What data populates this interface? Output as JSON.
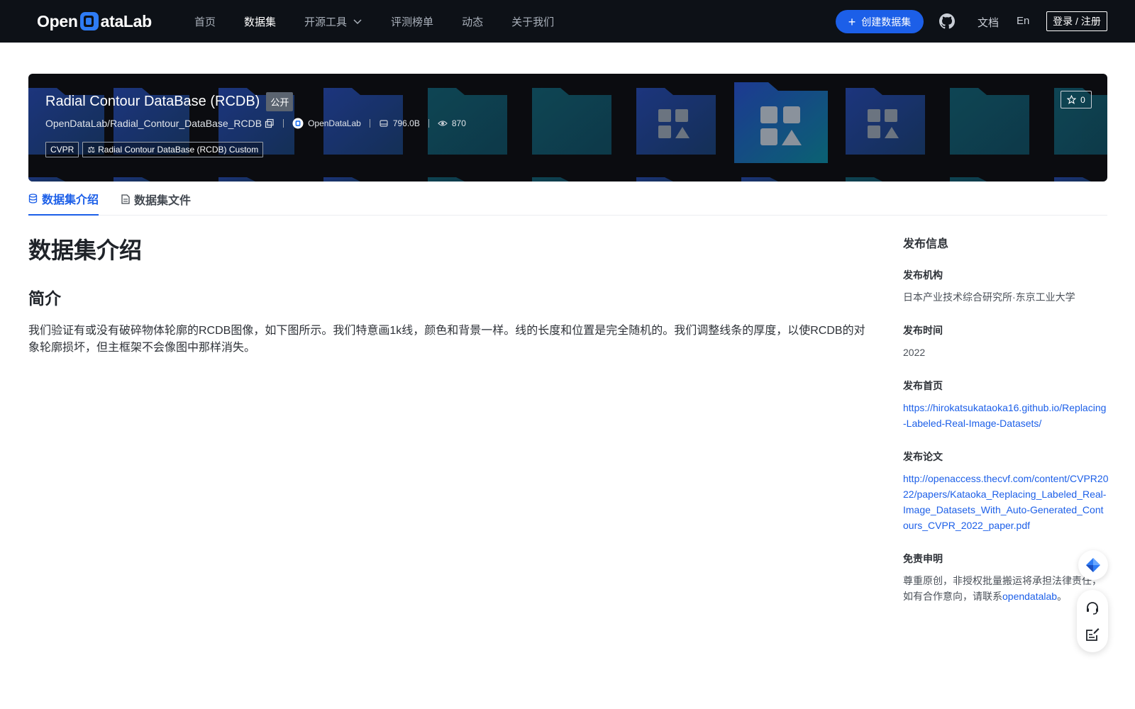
{
  "brand": {
    "logo_text_left": "Open",
    "logo_text_right": "ataLab",
    "logo_mark": "D",
    "accent_color": "#1c5fe8",
    "nav_bg": "#0d1117"
  },
  "nav": {
    "items": [
      {
        "label": "首页",
        "active": false
      },
      {
        "label": "数据集",
        "active": true
      },
      {
        "label": "开源工具",
        "active": false,
        "dropdown": true
      },
      {
        "label": "评测榜单",
        "active": false
      },
      {
        "label": "动态",
        "active": false
      },
      {
        "label": "关于我们",
        "active": false
      }
    ],
    "create_label": "创建数据集",
    "github_icon": "github-icon",
    "docs_label": "文档",
    "lang_label": "En",
    "login_label": "登录 / 注册"
  },
  "dataset": {
    "title": "Radial Contour DataBase (RCDB)",
    "visibility": "公开",
    "repo_path": "OpenDataLab/Radial_Contour_DataBase_RCDB",
    "publisher": "OpenDataLab",
    "size": "796.0B",
    "views": "870",
    "tags": [
      "CVPR",
      "Radial Contour DataBase (RCDB) Custom"
    ],
    "stars": "0"
  },
  "tabs": [
    {
      "label": "数据集介绍",
      "active": true,
      "icon": "database-icon"
    },
    {
      "label": "数据集文件",
      "active": false,
      "icon": "file-icon"
    }
  ],
  "content": {
    "heading": "数据集介绍",
    "subheading": "简介",
    "paragraph": "我们验证有或没有破碎物体轮廓的RCDB图像，如下图所示。我们特意画1k线，颜色和背景一样。线的长度和位置是完全随机的。我们调整线条的厚度，以使RCDB的对象轮廓损坏，但主框架不会像图中那样消失。"
  },
  "sidebar": {
    "title": "发布信息",
    "org_label": "发布机构",
    "org_value": "日本产业技术综合研究所·东京工业大学",
    "time_label": "发布时间",
    "time_value": "2022",
    "home_label": "发布首页",
    "home_value": "https://hirokatsukataoka16.github.io/Replacing-Labeled-Real-Image-Datasets/",
    "paper_label": "发布论文",
    "paper_value": "http://openaccess.thecvf.com/content/CVPR2022/papers/Kataoka_Replacing_Labeled_Real-Image_Datasets_With_Auto-Generated_Contours_CVPR_2022_paper.pdf",
    "disclaimer_label": "免责申明",
    "disclaimer_text": "尊重原创，非授权批量搬运将承担法律责任，如有合作意向，请联系",
    "disclaimer_link": "opendatalab",
    "disclaimer_end": "。"
  },
  "floating": {
    "top_icon": "diamond-icon",
    "headset_icon": "headset-icon",
    "feedback_icon": "edit-note-icon"
  }
}
